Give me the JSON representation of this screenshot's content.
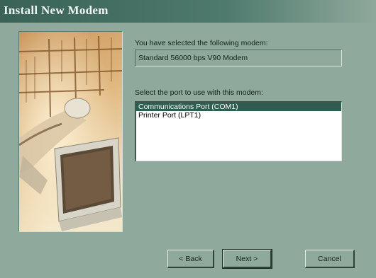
{
  "window": {
    "title": "Install New Modem"
  },
  "main": {
    "selected_label": "You have selected the following modem:",
    "modem_name": "Standard 56000 bps V90 Modem",
    "port_label": "Select the port to use with this modem:",
    "ports": [
      {
        "label": "Communications Port (COM1)",
        "selected": true
      },
      {
        "label": "Printer Port (LPT1)",
        "selected": false
      }
    ]
  },
  "buttons": {
    "back": "< Back",
    "next": "Next >",
    "cancel": "Cancel"
  },
  "colors": {
    "dialog_bg": "#8fa99c",
    "title_bar": "#3a6257",
    "selection": "#2f5c4f"
  }
}
